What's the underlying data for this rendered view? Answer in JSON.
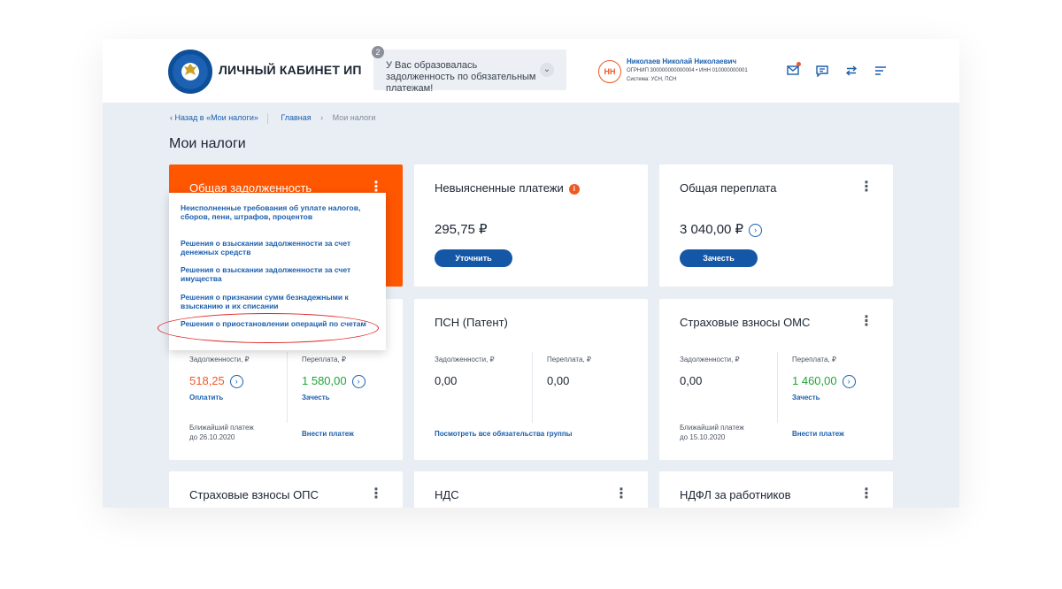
{
  "header": {
    "brand": "ЛИЧНЫЙ КАБИНЕТ ИП",
    "notice_count": "2",
    "notice_text": "У Вас образовалась задолженность по обязательным платежам!",
    "avatar_initials": "НН",
    "user_name": "Николаев Николай Николаевич",
    "user_ids": "ОГРНИП 300000000000004 • ИНН 010000000001",
    "user_system": "Система: УСН, ПСН",
    "icons": [
      "mail-icon",
      "chat-icon",
      "swap-icon",
      "menu-icon"
    ]
  },
  "breadcrumbs": {
    "back": "‹ Назад в «Мои налоги»",
    "home": "Главная",
    "arrow": "›",
    "current": "Мои налоги"
  },
  "page_title": "Мои налоги",
  "cards": {
    "debt": {
      "title": "Общая задолженность",
      "menu": [
        "Неисполненные требования об уплате налогов, сборов, пени, штрафов, процентов",
        "Решения о взыскании задолженности за счет денежных средств",
        "Решения о взыскании задолженности за счет имущества",
        "Решения о признании сумм безнадежными к взысканию и их списании",
        "Решения о приостановлении операций по счетам"
      ]
    },
    "unclear": {
      "title": "Невыясненные платежи",
      "amount": "295,75 ₽",
      "button": "Уточнить"
    },
    "overpay": {
      "title": "Общая переплата",
      "amount": "3 040,00 ₽",
      "button": "Зачесть"
    },
    "usn": {
      "debt_label": "Задолженности, ₽",
      "debt_value": "518,25",
      "debt_action": "Оплатить",
      "over_label": "Переплата, ₽",
      "over_value": "1 580,00",
      "over_action": "Зачесть",
      "next_label": "Ближайший платеж",
      "next_date": "до 26.10.2020",
      "make_payment": "Внести платеж"
    },
    "psn": {
      "title": "ПСН (Патент)",
      "debt_label": "Задолженности, ₽",
      "debt_value": "0,00",
      "over_label": "Переплата, ₽",
      "over_value": "0,00",
      "view_all": "Посмотреть все обязательства группы"
    },
    "oms": {
      "title": "Страховые взносы ОМС",
      "debt_label": "Задолженности, ₽",
      "debt_value": "0,00",
      "over_label": "Переплата, ₽",
      "over_value": "1 460,00",
      "over_action": "Зачесть",
      "next_label": "Ближайший платеж",
      "next_date": "до 15.10.2020",
      "make_payment": "Внести платеж"
    },
    "ops": {
      "title": "Страховые взносы ОПС"
    },
    "nds": {
      "title": "НДС"
    },
    "ndfl": {
      "title": "НДФЛ за работников"
    }
  },
  "colors": {
    "accent": "#1b5fae",
    "orange": "#ff5600",
    "debt": "#ee5a24",
    "positive": "#20a53a"
  }
}
